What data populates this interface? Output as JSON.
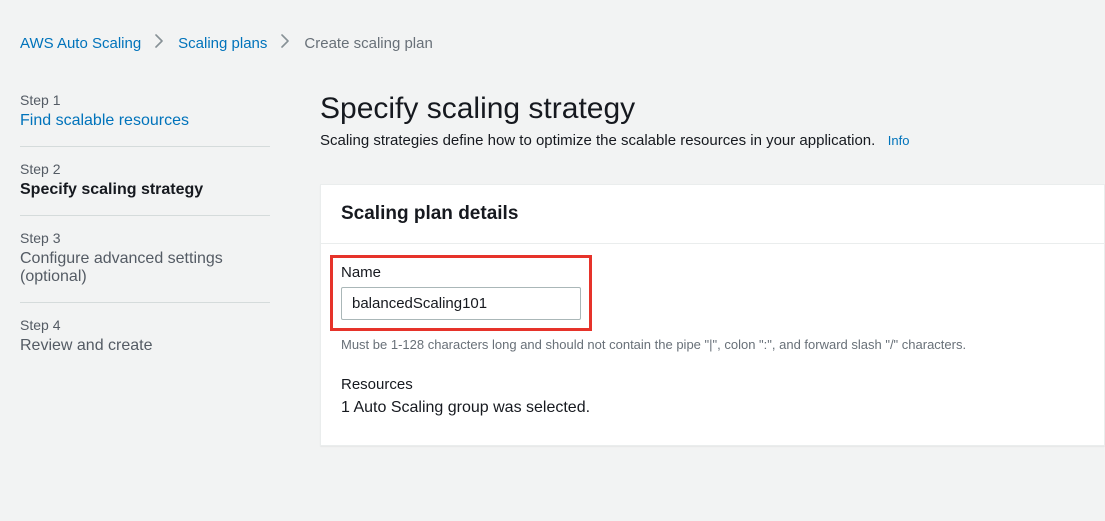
{
  "breadcrumb": {
    "root": "AWS Auto Scaling",
    "plans": "Scaling plans",
    "current": "Create scaling plan"
  },
  "sidebar": {
    "steps": [
      {
        "num": "Step 1",
        "title": "Find scalable resources"
      },
      {
        "num": "Step 2",
        "title": "Specify scaling strategy"
      },
      {
        "num": "Step 3",
        "title": "Configure advanced settings (optional)"
      },
      {
        "num": "Step 4",
        "title": "Review and create"
      }
    ]
  },
  "main": {
    "title": "Specify scaling strategy",
    "desc": "Scaling strategies define how to optimize the scalable resources in your application.",
    "info": "Info"
  },
  "panel": {
    "header": "Scaling plan details",
    "name_label": "Name",
    "name_value": "balancedScaling101",
    "name_hint": "Must be 1-128 characters long and should not contain the pipe \"|\", colon \":\", and forward slash \"/\" characters.",
    "resources_label": "Resources",
    "resources_value": "1 Auto Scaling group was selected."
  }
}
